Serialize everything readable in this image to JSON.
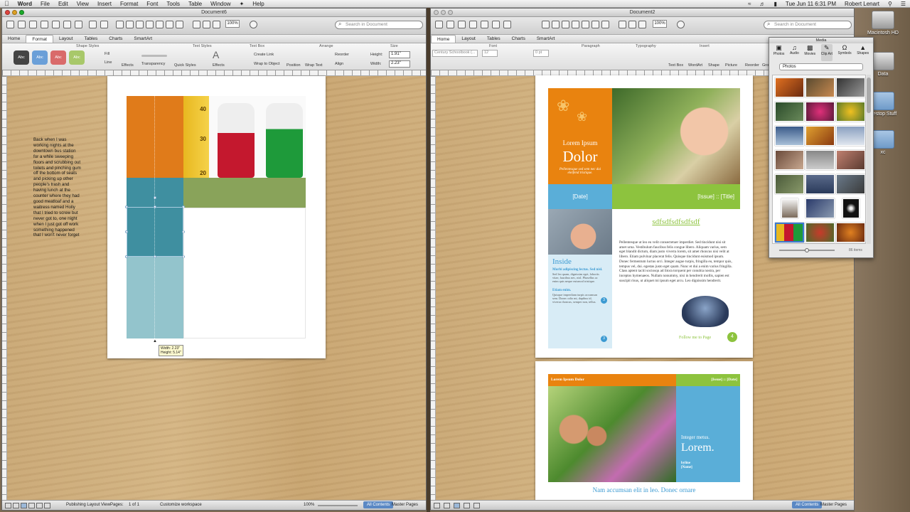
{
  "menubar": {
    "app": "Word",
    "items": [
      "File",
      "Edit",
      "View",
      "Insert",
      "Format",
      "Font",
      "Tools",
      "Table",
      "Window",
      "Help"
    ],
    "clock": "Tue Jun 11  6:31 PM",
    "user": "Robert Lenart"
  },
  "desktop": {
    "icons": [
      "Macintosh HD",
      "Data",
      "Destop Stuff",
      "xc"
    ]
  },
  "left_window": {
    "title": "Document6",
    "zoom": "100%",
    "search_placeholder": "Search in Document",
    "tabs": [
      "Home",
      "Format",
      "Layout",
      "Tables",
      "Charts",
      "SmartArt"
    ],
    "active_tab": "Format",
    "groups": [
      "Shape Styles",
      "Text Styles",
      "Text Box",
      "Arrange",
      "Size"
    ],
    "style_swatches": [
      "Abc",
      "Abc",
      "Abc",
      "Abc"
    ],
    "fill_label": "Fill",
    "line_label": "Line",
    "effects_label": "Effects",
    "transparency_label": "Transparency",
    "quick_styles_label": "Quick Styles",
    "text_effects_label": "Effects",
    "create_link": "Create Link",
    "wrap_to_object": "Wrap to Object",
    "position_label": "Position",
    "wrap_text_label": "Wrap Text",
    "reorder_label": "Reorder",
    "align_label": "Align",
    "height_label": "Height:",
    "height_value": "1.91\"",
    "width_label": "Width:",
    "width_value": "2.23\"",
    "body_text": "Back when I was working nights at the downtown bus station for a while sweeping floors and scrubbing out toilets and pinching gum off the bottom of seats and picking up other people's trash and having lunch at the counter where they had good meatloaf and a waitress named Holly that I tried to screw but never got to, one night when I just got off work something happened that I won't never forget",
    "ruler_marks": [
      40,
      30,
      20
    ],
    "tooltip_line1": "Width: 2.23\"",
    "tooltip_line2": "Height: 5.14\"",
    "status_view": "Publishing Layout View",
    "status_pages_label": "Pages:",
    "status_pages": "1 of 1",
    "status_workspace": "Customize workspace",
    "status_zoom": "100%",
    "status_all": "All Contents",
    "status_master": "Master Pages"
  },
  "right_window": {
    "title": "Document2",
    "zoom": "100%",
    "search_placeholder": "Search in Document",
    "tabs": [
      "Home",
      "Layout",
      "Tables",
      "Charts",
      "SmartArt"
    ],
    "groups": [
      "Font",
      "Paragraph",
      "Typography",
      "Insert"
    ],
    "font_name": "Century Schoolbook (...",
    "font_size": "12",
    "spacing": "0 pt",
    "insert_buttons": [
      "Text Box",
      "WordArt",
      "Shape",
      "Picture",
      "Reorder",
      "Group"
    ],
    "page1": {
      "lorem_ipsum": "Lorem Ipsum",
      "dolor": "Dolor",
      "tagline": "Pellentesque sed sem nec dui eleifend tristique.",
      "date": "[Date]",
      "issue_title": "[Issue] :: [Title]",
      "heading": "sdfsdfsdfsdfsdf",
      "inside": "Inside",
      "inside_item1_title": "Morbi adipiscing lectus. Sed nisl.",
      "inside_item1_body": "Sed leo quam, dignissim eget, lobortis vitae, faucibus nec, nisl. Phasellus ac enim quis neque euismod tristique.",
      "inside_item1_page": "3",
      "inside_item2_title": "Etiam enim.",
      "inside_item2_body": "Quisque imperdiam turpis accumsan sem. Donec odio mi, dapibus id, viverra rhoncus, semper non, tellus.",
      "inside_item2_page": "3",
      "body": "Pellentesque ut leo eu velit consectetuer imperdiet. Sed tincidunt nisi sit amet urna. Vestibulum faucibus felis congue libero. Aliquam varius, sem eget blandit dictum, diam justo viverra lorem, sit amet rhoncus nisi velit at libero. Etiam pulvinar placerat felis. Quisque tincidunt euismod ipsum. Donec fermentum luctus orci. Integer augue turpis, fringilla eu, tempor quis, tempus vel, dui. egestas justo eget quam. Nunc et dui a enim varius fringilla. Class aptent taciti sociosqu ad litora torquent per conubia nostra, per inceptos hymenaeos. Nullam nonummy, nisi in hendrerit mollis, sapien est suscipit risus, ut aliquet mi ipsum eget arcu. Leo dignissim hendrerit.",
      "follow": "Follow me to Page",
      "follow_page": "4"
    },
    "page2": {
      "header_left": "Lorem Ipsum Dolor",
      "header_right": "[Issue] :: [Date]",
      "integer": "Integer metus.",
      "lorem": "Lorem.",
      "byline": "byline",
      "name": "[Name]",
      "footer_heading": "Nam accumsan elit in leo. Donec ornare"
    },
    "status_all": "All Contents",
    "status_master": "Master Pages"
  },
  "media_panel": {
    "title": "Media",
    "tabs": [
      "Photos",
      "Audio",
      "Movies",
      "Clip Art",
      "Symbols",
      "Shapes"
    ],
    "selected": "Photos",
    "count": "86 items"
  }
}
